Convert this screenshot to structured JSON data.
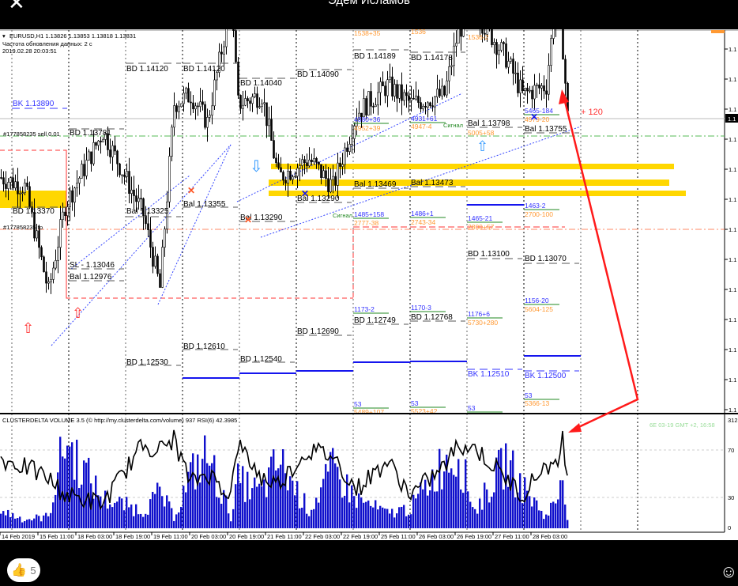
{
  "window": {
    "title": "Эдем Исламов",
    "close_icon": "close-icon",
    "likes": "5",
    "like_icon": "thumbs-up-icon",
    "emoji_icon": "smiley-icon"
  },
  "header": {
    "symbol_line": "EURUSD,H1  1.13826 1.13853 1.13818 1.13831",
    "refresh": "Частота обновления данных: 2 с",
    "datetime": "2019.02.28 20:03:51"
  },
  "indicator": {
    "title": "CLUSTERDELTA VOLUME 3.5 (© http://my.clusterdelta.com/volume) 937  RSI(6) 42.3985",
    "info": "6E 03-19 GMT +2, 16:58",
    "axis": [
      "312",
      "70",
      "30",
      "0"
    ]
  },
  "orders": {
    "sell": "#177858235 sell 0.01",
    "tp": "#177858235 tp"
  },
  "annotation": {
    "pips": "+ 120",
    "signal": "Сигнал"
  },
  "price_axis_label": "1.1",
  "levels": [
    "BD 1.14120",
    "BD 1.14120",
    "BD 1.14040",
    "BD 1.14090",
    "BD 1.14189",
    "BD 1.14178",
    "BK 1.13890",
    "BD 1.13781",
    "BD 1.13370",
    "Bal 1.13325",
    "Bal 1.13355",
    "Bal 1.13290",
    "Bal 1.13290",
    "Bal 1.13469",
    "Bal 1.13473",
    "SL - 1.13046",
    "Bal 1.12976",
    "BD 1.13100",
    "BD 1.13070",
    "BD 1.12530",
    "BD 1.12610",
    "BD 1.12540",
    "BD 1.12690",
    "BD 1.12749",
    "BD 1.12768",
    "BK 1.12510",
    "BK 1.12500",
    "Bal 1.13798",
    "Bal 1.13755"
  ],
  "blue_stats": [
    "4880+36",
    "4931+61",
    "5465-184",
    "1485+158",
    "1486+1",
    "1465-21",
    "1463-2",
    "1173-2",
    "1170-3",
    "1176+6",
    "1156-20",
    "53",
    "53",
    "53",
    "53"
  ],
  "orange_stats": [
    "1538+35",
    "1536",
    "1536-2",
    "4952+39",
    "4947-4",
    "5005+58",
    "4979-20",
    "2777-38",
    "2743-34",
    "2800+57",
    "2700-100",
    "5604-125",
    "5730+280",
    "5489+107",
    "5523+42",
    "5366-13"
  ],
  "colors": {
    "bull": "#ffffff",
    "bear": "#000000",
    "volume": "#1010cc",
    "band": "#ffd700",
    "arrow": "#ff0000",
    "blue": "#3333ff",
    "orange": "#ff9933"
  },
  "chart_data": {
    "type": "line",
    "title": "EURUSD,H1",
    "xlabel": "",
    "ylabel": "",
    "x_ticks": [
      "14 Feb 2019",
      "15 Feb 11:00",
      "18 Feb 03:00",
      "18 Feb 19:00",
      "19 Feb 11:00",
      "20 Feb 03:00",
      "20 Feb 19:00",
      "21 Feb 11:00",
      "22 Feb 03:00",
      "22 Feb 19:00",
      "25 Feb 11:00",
      "26 Feb 03:00",
      "26 Feb 19:00",
      "27 Feb 11:00",
      "28 Feb 03:00"
    ],
    "price_path_hour_index": [
      0,
      10,
      20,
      27,
      43,
      60,
      67,
      73,
      80,
      87,
      97,
      100,
      110,
      117,
      130,
      140,
      150,
      163,
      173,
      187,
      193,
      200,
      213,
      220,
      230,
      235,
      237,
      239
    ],
    "price_path": [
      1.135,
      1.1345,
      1.1288,
      1.1335,
      1.1375,
      1.133,
      1.129,
      1.139,
      1.1395,
      1.138,
      1.1445,
      1.139,
      1.1395,
      1.135,
      1.136,
      1.1345,
      1.1385,
      1.14,
      1.139,
      1.1395,
      1.143,
      1.144,
      1.1415,
      1.1395,
      1.14,
      1.146,
      1.142,
      1.1383
    ],
    "rsi_path": [
      62,
      55,
      45,
      30,
      22,
      75,
      70,
      80,
      40,
      50,
      30,
      75,
      45,
      40,
      70,
      65,
      35,
      60,
      30,
      55,
      75,
      72,
      45,
      30,
      58,
      52,
      88,
      42
    ],
    "volume_path": [
      60,
      30,
      40,
      300,
      100,
      60,
      120,
      40,
      180,
      250,
      40,
      160,
      120,
      230,
      60,
      200,
      100,
      50,
      70,
      230,
      250,
      60,
      230,
      140,
      40,
      110,
      240,
      30
    ],
    "ylim_indicator": [
      0,
      312
    ]
  }
}
